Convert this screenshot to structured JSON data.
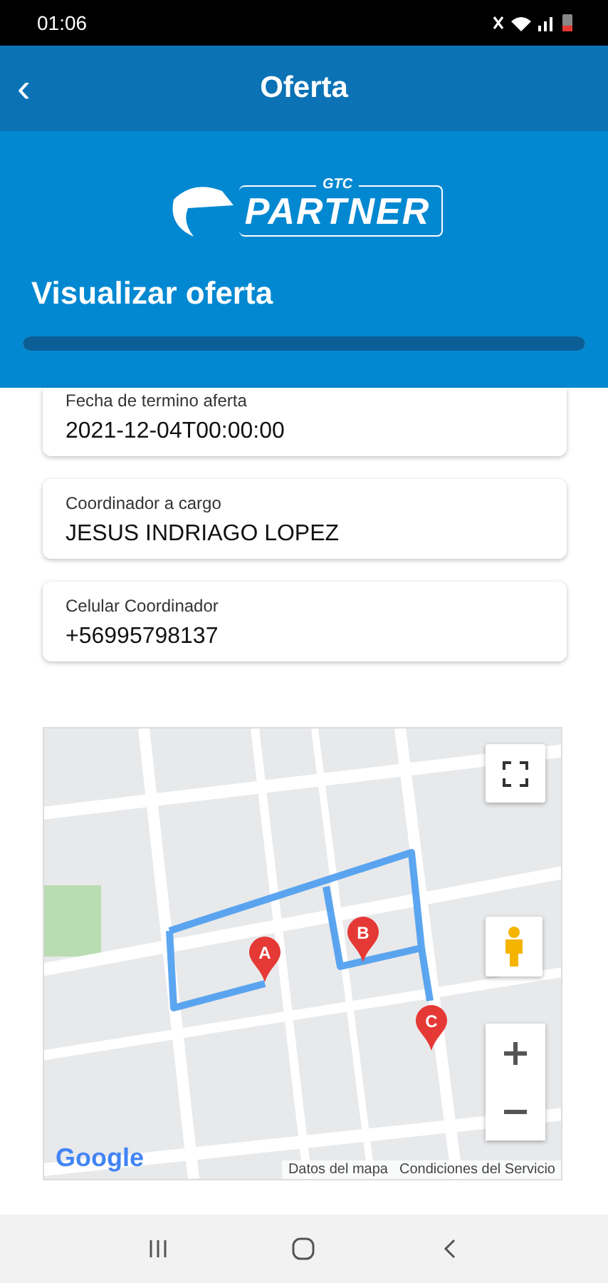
{
  "status_bar": {
    "time": "01:06"
  },
  "app_bar": {
    "back": "‹",
    "title": "Oferta"
  },
  "header": {
    "logo": {
      "top": "GTC",
      "main": "PARTNER"
    },
    "heading": "Visualizar oferta",
    "progress": {
      "level": 1
    }
  },
  "fields": [
    {
      "label": "Fecha de termino aferta",
      "value": "2021-12-04T00:00:00"
    },
    {
      "label": "Coordinador a cargo",
      "value": "JESUS INDRIAGO LOPEZ"
    },
    {
      "label": "Celular Coordinador",
      "value": "+56995798137"
    }
  ],
  "map": {
    "markers": [
      {
        "label": "A"
      },
      {
        "label": "B"
      },
      {
        "label": "C"
      }
    ],
    "logo": "Google",
    "attribution": [
      "Datos del mapa",
      "Condiciones del Servicio"
    ]
  }
}
